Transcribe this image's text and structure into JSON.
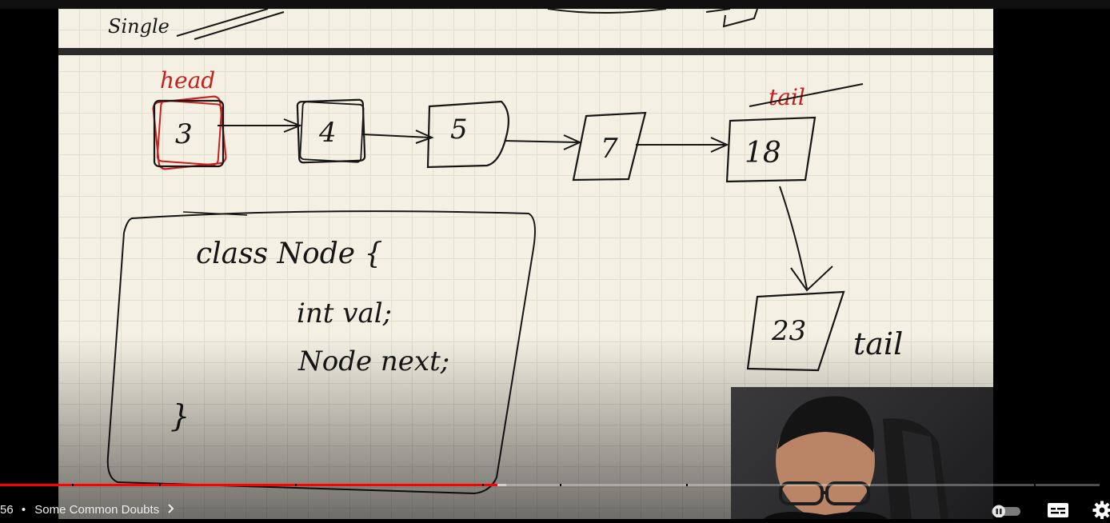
{
  "board": {
    "top_fragment": "Single",
    "head_label": "head",
    "old_tail_label": "tail",
    "nodes": [
      "3",
      "4",
      "5",
      "7",
      "18",
      "23"
    ],
    "new_tail_label": "tail",
    "code_lines": [
      "class Node {",
      "int val;",
      "Node next;",
      "}"
    ]
  },
  "player": {
    "time": "56",
    "separator": "•",
    "chapter_title": "Some Common Doubts",
    "progress_played": 0.452,
    "progress_buffered": 0.46
  },
  "colors": {
    "board_bg": "#f4f1e4",
    "ink": "#161616",
    "head_ink": "#c8201e",
    "progress": "#ff0000"
  },
  "icons": {
    "chapter_chevron": "chevron-right-icon",
    "autoplay": "autoplay-toggle-icon",
    "subtitles": "subtitles-icon",
    "settings": "settings-gear-icon"
  }
}
